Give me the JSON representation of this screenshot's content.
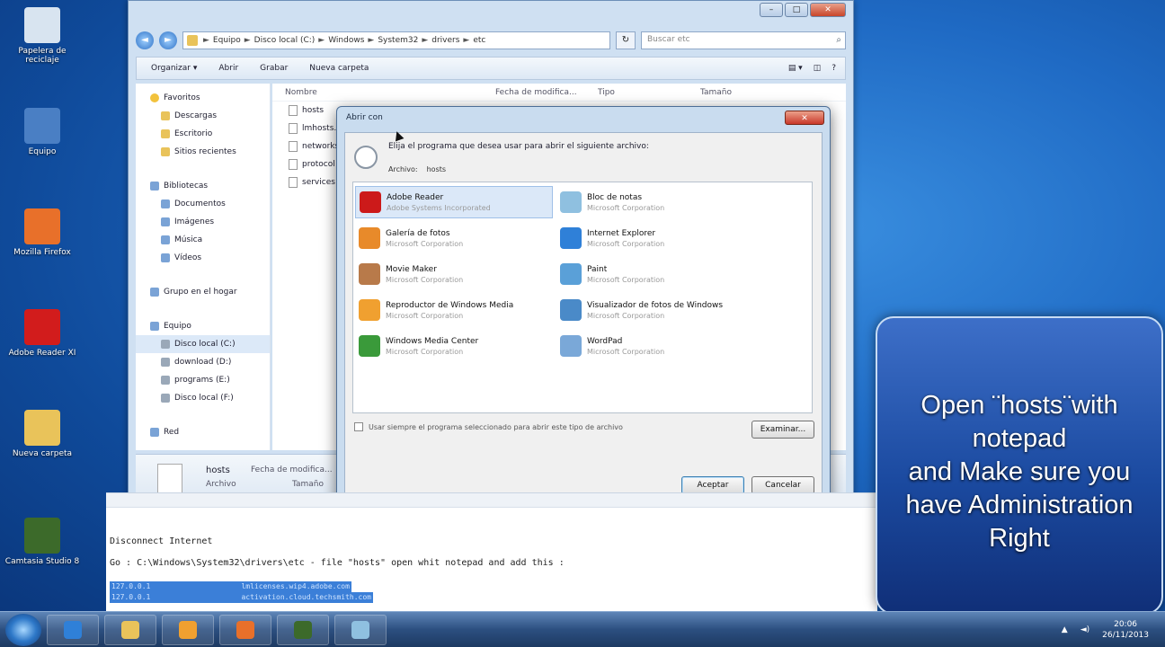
{
  "desktop": {
    "icons": [
      {
        "label": "Papelera de reciclaje",
        "color": "#d8e4f0"
      },
      {
        "label": "Equipo",
        "color": "#4a7fc4"
      },
      {
        "label": "Mozilla Firefox",
        "color": "#e8702a"
      },
      {
        "label": "Adobe Reader XI",
        "color": "#d21c1c"
      },
      {
        "label": "Nueva carpeta",
        "color": "#e9c35a"
      },
      {
        "label": "Camtasia Studio 8",
        "color": "#3c6a2a"
      }
    ]
  },
  "explorer": {
    "window_controls": {
      "minimize": "–",
      "maximize": "□",
      "close": "✕"
    },
    "nav": {
      "back": "◄",
      "forward": "►"
    },
    "address_crumbs": [
      "Equipo",
      "Disco local (C:)",
      "Windows",
      "System32",
      "drivers",
      "etc"
    ],
    "address_sep": "►",
    "search_placeholder": "Buscar etc",
    "toolbar": {
      "organize": "Organizar ▾",
      "open": "Abrir",
      "record": "Grabar",
      "new_folder": "Nueva carpeta"
    },
    "nav_pane": [
      {
        "label": "Favoritos",
        "kind": "star",
        "group": true
      },
      {
        "label": "Descargas",
        "kind": "folder"
      },
      {
        "label": "Escritorio",
        "kind": "folder"
      },
      {
        "label": "Sitios recientes",
        "kind": "folder"
      },
      {
        "label": "Bibliotecas",
        "kind": "lib",
        "group": true
      },
      {
        "label": "Documentos",
        "kind": "lib"
      },
      {
        "label": "Imágenes",
        "kind": "lib"
      },
      {
        "label": "Música",
        "kind": "lib"
      },
      {
        "label": "Vídeos",
        "kind": "lib"
      },
      {
        "label": "Grupo en el hogar",
        "kind": "lib",
        "group": true
      },
      {
        "label": "Equipo",
        "kind": "lib",
        "group": true
      },
      {
        "label": "Disco local (C:)",
        "kind": "drive",
        "selected": true
      },
      {
        "label": "download (D:)",
        "kind": "drive"
      },
      {
        "label": "programs (E:)",
        "kind": "drive"
      },
      {
        "label": "Disco local (F:)",
        "kind": "drive"
      },
      {
        "label": "Red",
        "kind": "lib",
        "group": true
      }
    ],
    "columns": [
      "Nombre",
      "Fecha de modifica...",
      "Tipo",
      "Tamaño"
    ],
    "files": [
      "hosts",
      "lmhosts.sam",
      "networks",
      "protocol",
      "services"
    ],
    "details": {
      "name": "hosts",
      "type": "Archivo",
      "modified_label": "Fecha de modifica...",
      "size_label": "Tamaño"
    }
  },
  "dialog": {
    "title": "Abrir con",
    "close": "✕",
    "instruction": "Elija el programa que desea usar para abrir el siguiente archivo:",
    "file_label": "Archivo:",
    "file_name": "hosts",
    "programs": [
      {
        "name": "Adobe Reader",
        "company": "Adobe Systems Incorporated",
        "color": "#cc1a1a",
        "selected": true
      },
      {
        "name": "Bloc de notas",
        "company": "Microsoft Corporation",
        "color": "#8fc0e0"
      },
      {
        "name": "Galería de fotos",
        "company": "Microsoft Corporation",
        "color": "#e88a2a"
      },
      {
        "name": "Internet Explorer",
        "company": "Microsoft Corporation",
        "color": "#2f80d8"
      },
      {
        "name": "Movie Maker",
        "company": "Microsoft Corporation",
        "color": "#b87a4a"
      },
      {
        "name": "Paint",
        "company": "Microsoft Corporation",
        "color": "#5aa0d8"
      },
      {
        "name": "Reproductor de Windows Media",
        "company": "Microsoft Corporation",
        "color": "#f0a030"
      },
      {
        "name": "Visualizador de fotos de Windows",
        "company": "Microsoft Corporation",
        "color": "#4a8ac8"
      },
      {
        "name": "Windows Media Center",
        "company": "Microsoft Corporation",
        "color": "#3a9a3a"
      },
      {
        "name": "WordPad",
        "company": "Microsoft Corporation",
        "color": "#7aa8d8"
      }
    ],
    "always_use": "Usar siempre el programa seleccionado para abrir este tipo de archivo",
    "browse": "Examinar...",
    "accept": "Aceptar",
    "cancel": "Cancelar"
  },
  "console": {
    "line1": "Disconnect Internet",
    "line2": "Go : C:\\Windows\\System32\\drivers\\etc - file \"hosts\" open whit notepad and add this :",
    "hl1": "127.0.0.1                     lmlicenses.wip4.adobe.com",
    "hl2": "127.0.0.1                     activation.cloud.techsmith.com"
  },
  "overlay": {
    "text": "Open ¨hosts¨with\nnotepad\nand Make sure you\nhave Administration\nRight"
  },
  "taskbar": {
    "apps": [
      {
        "name": "explorer",
        "color": "#e9c35a"
      },
      {
        "name": "media-player",
        "color": "#f0a030"
      },
      {
        "name": "firefox",
        "color": "#e8702a"
      },
      {
        "name": "camtasia",
        "color": "#3c6a2a"
      },
      {
        "name": "notepad",
        "color": "#8fc0e0"
      }
    ],
    "time": "20:06",
    "date": "26/11/2013"
  }
}
